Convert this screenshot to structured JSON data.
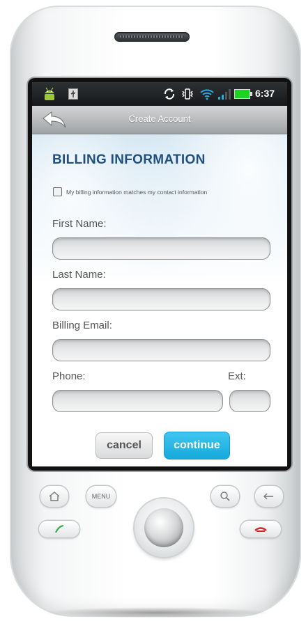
{
  "status_bar": {
    "time": "6:37",
    "icons": [
      "android-icon",
      "usb-icon",
      "sync-icon",
      "vibrate-icon",
      "wifi-icon",
      "signal-icon",
      "battery-icon"
    ]
  },
  "title_bar": {
    "title": "Create Account",
    "back_icon": "back-arrow-icon"
  },
  "form": {
    "heading": "BILLING INFORMATION",
    "checkbox_label": "My billing information matches my contact information",
    "checkbox_checked": false,
    "fields": {
      "first_name_label": "First Name:",
      "first_name_value": "",
      "last_name_label": "Last Name:",
      "last_name_value": "",
      "billing_email_label": "Billing Email:",
      "billing_email_value": "",
      "phone_label": "Phone:",
      "phone_value": "",
      "ext_label": "Ext:",
      "ext_value": ""
    },
    "buttons": {
      "cancel": "cancel",
      "continue": "continue"
    }
  },
  "hardware": {
    "menu_label": "MENU",
    "buttons": [
      "home-icon",
      "menu-button",
      "trackball",
      "search-icon",
      "back-icon",
      "call-icon",
      "end-call-icon"
    ]
  },
  "colors": {
    "heading": "#1f4f7f",
    "continue_button": "#1fb3e4",
    "status_bar": "#1e2022"
  }
}
